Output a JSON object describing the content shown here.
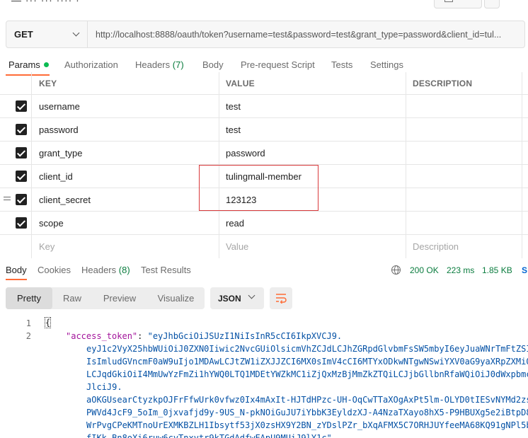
{
  "request": {
    "method": "GET",
    "url": "http://localhost:8888/oauth/token?username=test&password=test&grant_type=password&client_id=tul..."
  },
  "request_tabs": {
    "params": "Params",
    "authorization": "Authorization",
    "headers": "Headers",
    "headers_count": "(7)",
    "body": "Body",
    "pre_request_script": "Pre-request Script",
    "tests": "Tests",
    "settings": "Settings"
  },
  "params_table": {
    "columns": {
      "key": "KEY",
      "value": "VALUE",
      "description": "DESCRIPTION"
    },
    "rows": [
      {
        "key": "username",
        "value": "test"
      },
      {
        "key": "password",
        "value": "test"
      },
      {
        "key": "grant_type",
        "value": "password"
      },
      {
        "key": "client_id",
        "value": "tulingmall-member"
      },
      {
        "key": "client_secret",
        "value": "123123"
      },
      {
        "key": "scope",
        "value": "read"
      }
    ],
    "placeholders": {
      "key": "Key",
      "value": "Value",
      "description": "Description"
    }
  },
  "response_tabs": {
    "body": "Body",
    "cookies": "Cookies",
    "headers": "Headers",
    "headers_count": "(8)",
    "test_results": "Test Results"
  },
  "response_status": {
    "status": "200 OK",
    "time": "223 ms",
    "size": "1.85 KB",
    "save": "S"
  },
  "view_modes": {
    "pretty": "Pretty",
    "raw": "Raw",
    "preview": "Preview",
    "visualize": "Visualize",
    "format": "JSON"
  },
  "response_body": {
    "line_numbers": [
      "1",
      "2"
    ],
    "open_brace": "{",
    "key": "\"access_token\"",
    "colon": ": ",
    "token_lines": [
      "\"eyJhbGciOiJSUzI1NiIsInR5cCI6IkpXVCJ9.",
      "eyJ1c2VyX25hbWUiOiJ0ZXN0Iiwic2NvcGUiOlsicmVhZCJdLCJhZGRpdGlvbmFsSW5mbyI6eyJuaWNrTmFtZSI",
      "IsImludGVncmF0aW9uIjo1MDAwLCJtZW1iZXJJZCI6MX0sImV4cCI6MTYxODkwNTgwNSwiYXV0aG9yaXRpZXMiO",
      "LCJqdGkiOiI4MmUwYzFmZi1hYWQ0LTQ1MDEtYWZkMC1iZjQxMzBjMmZkZTQiLCJjbGllbnRfaWQiOiJ0dWxpbmc",
      "JlciJ9.",
      "aOKGUsearCtyzkpOJFrFfwUrk0vfwz0Ix4mAxIt-HJTdHPzc-UH-OqCwTTaXOgAxPt5lm-OLYD0tIESvNYMd2zs",
      "PWVd4JcF9_5oIm_0jxvafjd9y-9US_N-pkNOiGuJU7iYbbK3EyldzXJ-A4NzaTXayo8hX5-P9HBUXg5e2iBtpD8",
      "WrPvgCPeKMTnoUrEXMKBZLH1Ibsytf53jX0zsHX9Y2BN_zYDslPZr_bXqAFMX5C7ORHJUYfeeMA68KQ91gNPl5b",
      "fIKk_Bn8oXi6ruw6cvTnxvtr9kTGdAdfwFApU9MUiJ9lY1c\","
    ]
  }
}
